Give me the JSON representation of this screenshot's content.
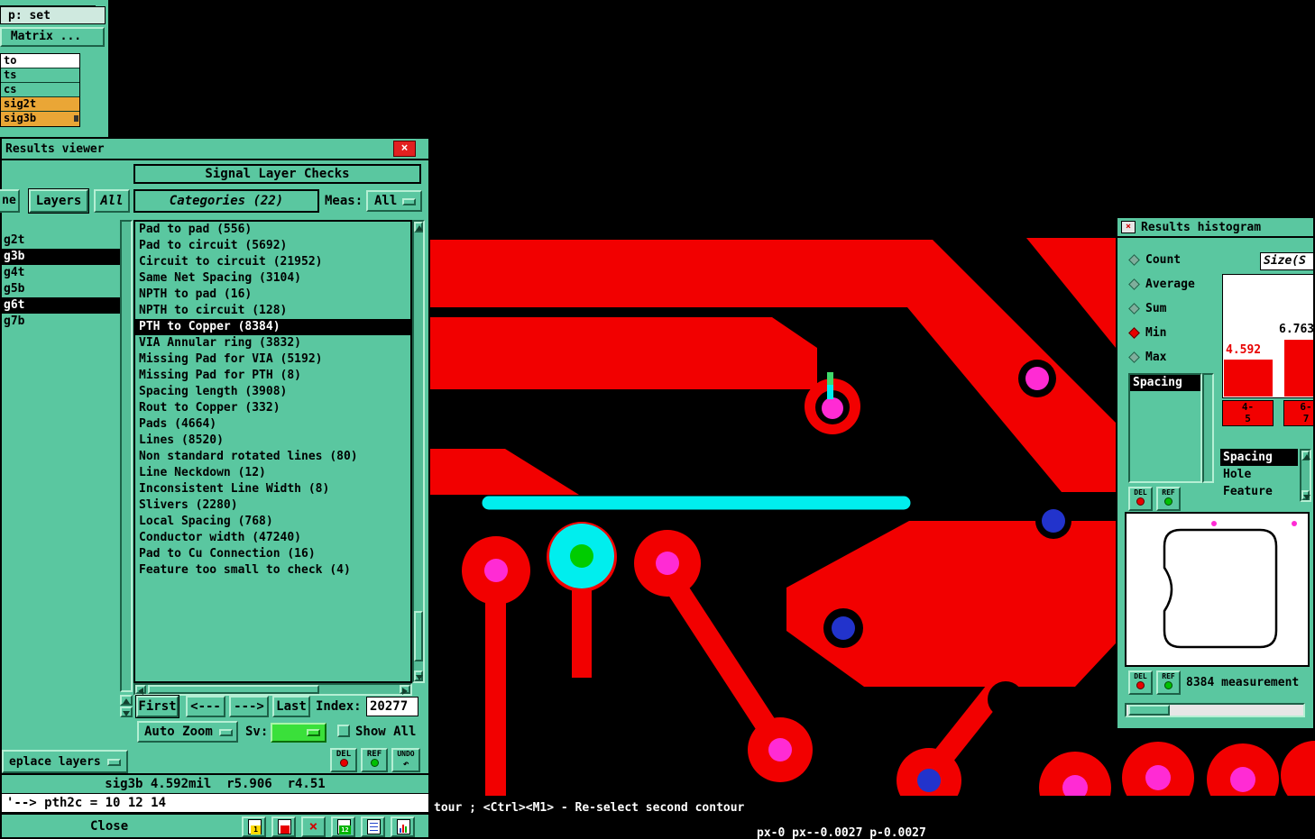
{
  "colors": {
    "teal": "#5ac7a0",
    "selection_bg": "#000000",
    "pcb_copper": "#f20000",
    "pad_magenta": "#ff2bd4",
    "pad_blue": "#2233cc",
    "pad_green": "#00cc00",
    "highlight_cyan": "#00eeee",
    "layer_orange": "#eaa636",
    "bar_red": "#f20000",
    "close_red": "#e22020",
    "sv_green": "#3ae03a"
  },
  "icons": {
    "close": "×",
    "x_mark": "×",
    "undo": "↶",
    "page1": "1",
    "page12": "12"
  },
  "sidebar": {
    "disp_value": "p: set",
    "matrix_button": " Matrix ...",
    "mini_list": [
      {
        "label": "to"
      },
      {
        "label": "ts"
      },
      {
        "label": "cs"
      },
      {
        "label": "sig2t"
      },
      {
        "label": "sig3b"
      }
    ]
  },
  "results_viewer": {
    "title": "Results viewer",
    "header": "Signal Layer Checks",
    "tab_partial": "ne",
    "tab_layers": "Layers",
    "tab_all": "All",
    "categories_header": "Categories (22)",
    "meas_label": "Meas:",
    "meas_value": "All",
    "layers": [
      {
        "label": "g2t",
        "selected": false
      },
      {
        "label": "g3b",
        "selected": true
      },
      {
        "label": "g4t",
        "selected": false
      },
      {
        "label": "g5b",
        "selected": false
      },
      {
        "label": "g6t",
        "selected": true
      },
      {
        "label": "g7b",
        "selected": false
      }
    ],
    "categories": [
      {
        "label": "Pad to pad (556)",
        "selected": false
      },
      {
        "label": "Pad to circuit (5692)",
        "selected": false
      },
      {
        "label": "Circuit to circuit (21952)",
        "selected": false
      },
      {
        "label": "Same Net Spacing (3104)",
        "selected": false
      },
      {
        "label": "NPTH to pad (16)",
        "selected": false
      },
      {
        "label": "NPTH to circuit (128)",
        "selected": false
      },
      {
        "label": "PTH to Copper (8384)",
        "selected": true
      },
      {
        "label": "VIA Annular ring (3832)",
        "selected": false
      },
      {
        "label": "Missing Pad for VIA (5192)",
        "selected": false
      },
      {
        "label": "Missing Pad for PTH (8)",
        "selected": false
      },
      {
        "label": "Spacing length (3908)",
        "selected": false
      },
      {
        "label": "Rout to Copper (332)",
        "selected": false
      },
      {
        "label": "Pads (4664)",
        "selected": false
      },
      {
        "label": "Lines (8520)",
        "selected": false
      },
      {
        "label": "Non standard rotated lines (80)",
        "selected": false
      },
      {
        "label": "Line Neckdown (12)",
        "selected": false
      },
      {
        "label": "Inconsistent Line Width (8)",
        "selected": false
      },
      {
        "label": "Slivers (2280)",
        "selected": false
      },
      {
        "label": "Local Spacing (768)",
        "selected": false
      },
      {
        "label": "Conductor width (47240)",
        "selected": false
      },
      {
        "label": "Pad to Cu Connection (16)",
        "selected": false
      },
      {
        "label": "Feature too small to check (4)",
        "selected": false
      }
    ],
    "nav": {
      "first": "First",
      "prev": "<---",
      "next": "--->",
      "last": "Last",
      "index_label": "Index:",
      "index_value": "20277"
    },
    "options": {
      "auto_zoom": "Auto Zoom",
      "sv_label": "Sv:",
      "show_all": "Show All"
    },
    "actions": {
      "del": "DEL",
      "ref": "REF",
      "undo": "UNDO"
    },
    "replace_layers": "eplace layers",
    "status_line": "sig3b 4.592mil  r5.906  r4.51",
    "command_line": "'--> pth2c = 10 12 14",
    "close_button": "Close"
  },
  "histogram": {
    "title": "Results histogram",
    "stats": [
      {
        "label": "Count",
        "selected": false
      },
      {
        "label": "Average",
        "selected": false
      },
      {
        "label": "Sum",
        "selected": false
      },
      {
        "label": "Min",
        "selected": true
      },
      {
        "label": "Max",
        "selected": false
      }
    ],
    "size_header": "Size(S",
    "measure_list": [
      {
        "label": "Spacing",
        "selected": true
      }
    ],
    "category_list": [
      {
        "label": "Spacing",
        "selected": true
      },
      {
        "label": "Hole",
        "selected": false
      },
      {
        "label": "Feature",
        "selected": false
      }
    ],
    "del_label": "DEL",
    "ref_label": "REF",
    "measurement_label": "8384 measurement",
    "chart_data": {
      "type": "bar",
      "stat": "Min",
      "series_name": "Spacing",
      "categories": [
        "4-5",
        "6-7"
      ],
      "values": [
        4.592,
        6.763
      ],
      "bar_labels": [
        "4.592",
        "6.763"
      ],
      "bins": [
        {
          "line1": "4-",
          "line2": "5"
        },
        {
          "line1": "6-",
          "line2": "7"
        }
      ],
      "title": "Size(S",
      "bar_color": "#f20000",
      "grid": false,
      "legend": false
    }
  },
  "status_bar": {
    "help_text": "tour ; <Ctrl><M1> - Re-select second contour",
    "coords_text": "px-0 px--0.0027 p-0.0027"
  }
}
